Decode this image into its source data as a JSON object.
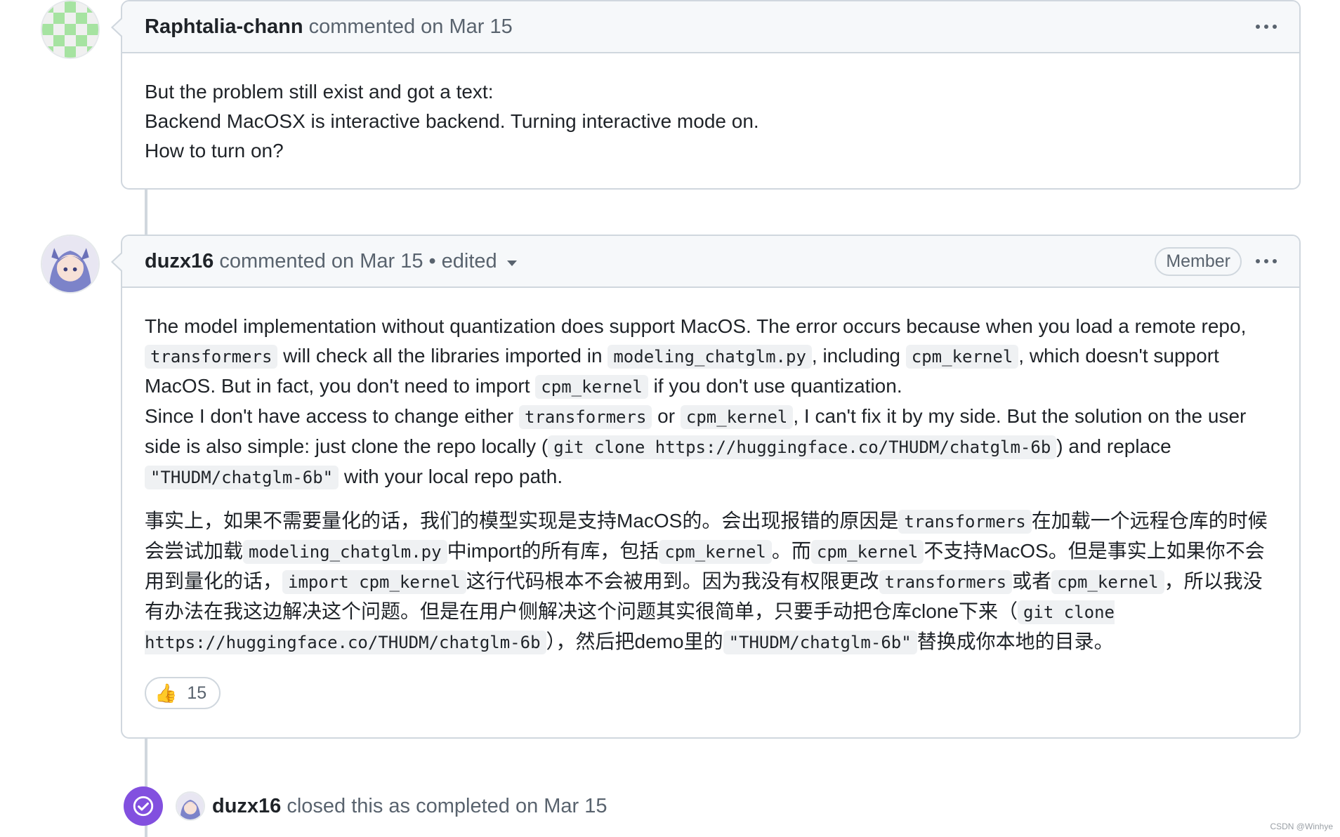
{
  "comment1": {
    "author": "Raphtalia-chann",
    "meta": "commented on Mar 15",
    "lines": [
      "But the problem still exist and got a text:",
      "Backend MacOSX is interactive backend. Turning interactive mode on.",
      "How to turn on?"
    ]
  },
  "comment2": {
    "author": "duzx16",
    "meta": "commented on Mar 15",
    "dot": "•",
    "edited": "edited",
    "badge": "Member",
    "en": {
      "t1": "The model implementation without quantization does support MacOS. The error occurs because when you load a remote repo, ",
      "c1": "transformers",
      "t2": " will check all the libraries imported in ",
      "c2": "modeling_chatglm.py",
      "t3": ", including ",
      "c3": "cpm_kernel",
      "t4": ", which doesn't support MacOS. But in fact, you don't need to import ",
      "c4": "cpm_kernel",
      "t5": " if you don't use quantization.",
      "t6": "Since I don't have access to change either ",
      "c5": "transformers",
      "t7": " or ",
      "c6": "cpm_kernel",
      "t8": ", I can't fix it by my side. But the solution on the user side is also simple: just clone the repo locally (",
      "c7": "git clone https://huggingface.co/THUDM/chatglm-6b",
      "t9": ") and replace ",
      "c8": "\"THUDM/chatglm-6b\"",
      "t10": " with your local repo path."
    },
    "zh": {
      "t1": "事实上，如果不需要量化的话，我们的模型实现是支持MacOS的。会出现报错的原因是",
      "c1": "transformers",
      "t2": "在加载一个远程仓库的时候会尝试加载",
      "c2": "modeling_chatglm.py",
      "t3": "中import的所有库，包括",
      "c3": "cpm_kernel",
      "t4": "。而",
      "c4": "cpm_kernel",
      "t5": "不支持MacOS。但是事实上如果你不会用到量化的话，",
      "c5": "import cpm_kernel",
      "t6": "这行代码根本不会被用到。因为我没有权限更改",
      "c6": "transformers",
      "t7": "或者",
      "c7": "cpm_kernel",
      "t8": "，所以我没有办法在我这边解决这个问题。但是在用户侧解决这个问题其实很简单，只要手动把仓库clone下来（",
      "c8": "git clone https://huggingface.co/THUDM/chatglm-6b",
      "t9": "），然后把demo里的",
      "c9": "\"THUDM/chatglm-6b\"",
      "t10": "替换成你本地的目录。"
    },
    "reaction": {
      "emoji": "👍",
      "count": "15"
    }
  },
  "event": {
    "author": "duzx16",
    "text": "closed this as completed on Mar 15"
  },
  "watermark": "CSDN @Winhye",
  "colors": {
    "closed_purple": "#8250df",
    "border": "#d0d7de",
    "header_bg": "#f6f8fa"
  }
}
